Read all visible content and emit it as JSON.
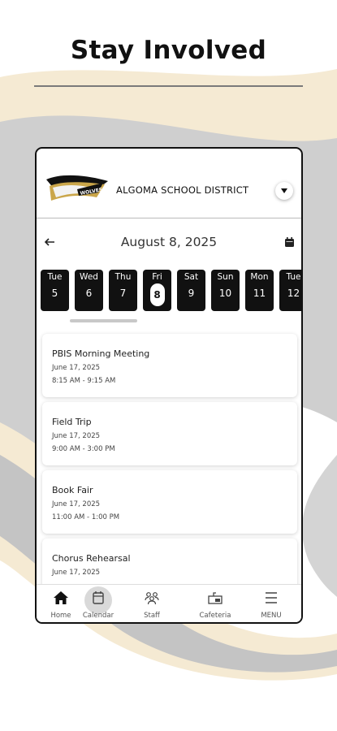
{
  "headline": "Stay Involved",
  "app": {
    "district_name": "ALGOMA SCHOOL DISTRICT",
    "logo_text": "WOLVES"
  },
  "calendar": {
    "current_date": "August 8, 2025",
    "days": [
      {
        "name": "Tue",
        "num": "5"
      },
      {
        "name": "Wed",
        "num": "6"
      },
      {
        "name": "Thu",
        "num": "7"
      },
      {
        "name": "Fri",
        "num": "8",
        "selected": true
      },
      {
        "name": "Sat",
        "num": "9"
      },
      {
        "name": "Sun",
        "num": "10"
      },
      {
        "name": "Mon",
        "num": "11"
      },
      {
        "name": "Tue",
        "num": "12"
      }
    ]
  },
  "events": [
    {
      "title": "PBIS Morning Meeting",
      "date": "June 17, 2025",
      "time": "8:15 AM - 9:15 AM"
    },
    {
      "title": "Field Trip",
      "date": "June 17, 2025",
      "time": "9:00 AM - 3:00 PM"
    },
    {
      "title": "Book Fair",
      "date": "June 17, 2025",
      "time": "11:00 AM - 1:00 PM"
    },
    {
      "title": "Chorus Rehearsal",
      "date": "June 17, 2025",
      "time": ""
    }
  ],
  "tabbar": [
    {
      "label": "Home",
      "icon": "home-icon",
      "active": true
    },
    {
      "label": "Calendar",
      "icon": "calendar-icon"
    },
    {
      "label": "Staff",
      "icon": "staff-icon"
    },
    {
      "label": "Cafeteria",
      "icon": "cafeteria-icon"
    },
    {
      "label": "MENU",
      "icon": "menu-icon"
    }
  ],
  "colors": {
    "accent_dark": "#111111",
    "background_swoosh_gray": "#cfcfcf",
    "background_swoosh_cream": "#f5ead3"
  }
}
